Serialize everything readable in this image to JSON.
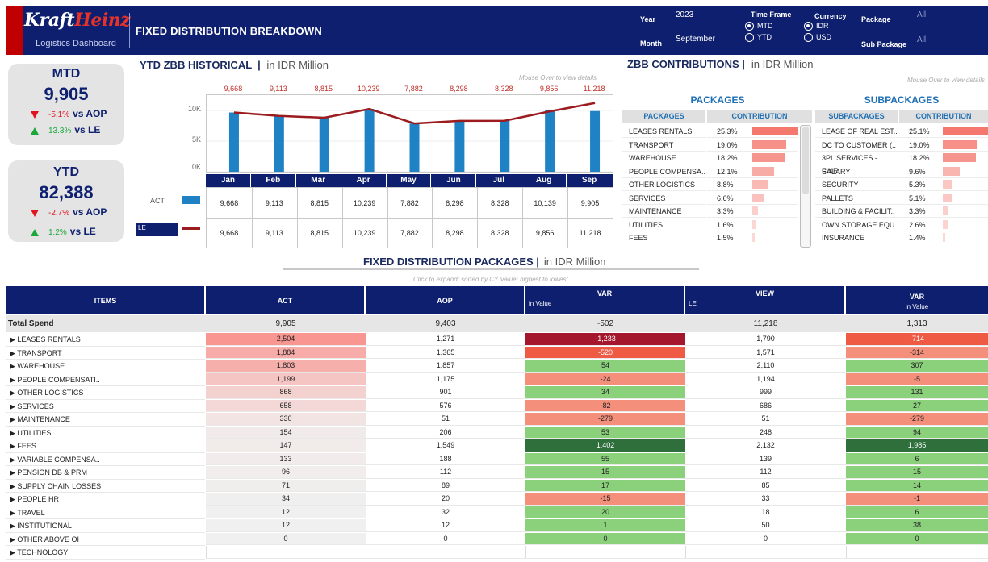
{
  "header": {
    "brand_kraft": "Kraft",
    "brand_heinz": "Heinz",
    "subtitle": "Logistics Dashboard",
    "title": "FIXED DISTRIBUTION BREAKDOWN",
    "filters": {
      "year_label": "Year",
      "year_value": "2023",
      "month_label": "Month",
      "month_value": "September",
      "timeframe_label": "Time Frame",
      "timeframe_options": [
        "MTD",
        "YTD"
      ],
      "timeframe_selected": "MTD",
      "currency_label": "Currency",
      "currency_options": [
        "IDR",
        "USD"
      ],
      "currency_selected": "IDR",
      "package_label": "Package",
      "package_value": "All",
      "subpackage_label": "Sub Package",
      "subpackage_value": "All"
    }
  },
  "kpis": [
    {
      "title": "MTD",
      "value": "9,905",
      "aop_pct": "-5.1%",
      "aop_label": "vs AOP",
      "aop_dir": "down",
      "le_pct": "13.3%",
      "le_label": "vs LE",
      "le_dir": "up"
    },
    {
      "title": "YTD",
      "value": "82,388",
      "aop_pct": "-2.7%",
      "aop_label": "vs AOP",
      "aop_dir": "down",
      "le_pct": "1.2%",
      "le_label": "vs LE",
      "le_dir": "up"
    }
  ],
  "ytd_section": {
    "title": "YTD ZBB HISTORICAL",
    "unit": "in IDR Million",
    "hint": "Mouse Over to view details",
    "legend_act": "ACT",
    "legend_le": "LE"
  },
  "chart_data": {
    "type": "bar",
    "categories": [
      "Jan",
      "Feb",
      "Mar",
      "Apr",
      "May",
      "Jun",
      "Jul",
      "Aug",
      "Sep"
    ],
    "series": [
      {
        "name": "ACT",
        "type": "bar",
        "values": [
          9668,
          9113,
          8815,
          10239,
          7882,
          8298,
          8328,
          10139,
          9905
        ],
        "labels": [
          "9,668",
          "9,113",
          "8,815",
          "10,239",
          "7,882",
          "8,298",
          "8,328",
          "10,139",
          "9,905"
        ]
      },
      {
        "name": "LE",
        "type": "line",
        "values": [
          9668,
          9113,
          8815,
          10239,
          7882,
          8298,
          8328,
          9856,
          11218
        ],
        "labels": [
          "9,668",
          "9,113",
          "8,815",
          "10,239",
          "7,882",
          "8,298",
          "8,328",
          "9,856",
          "11,218"
        ]
      }
    ],
    "yticks": [
      "0K",
      "5K",
      "10K"
    ],
    "ylim": [
      0,
      12500
    ],
    "colors": {
      "bar": "#1f82c4",
      "line": "#9b1b1f"
    }
  },
  "zbb": {
    "title": "ZBB CONTRIBUTIONS",
    "unit": "in IDR Million",
    "hint": "Mouse Over to view details",
    "packages_title": "PACKAGES",
    "subpackages_title": "SUBPACKAGES",
    "col_packages": "PACKAGES",
    "col_contribution": "CONTRIBUTION",
    "col_subpackages": "SUBPACKAGES",
    "packages": [
      {
        "name": "LEASES RENTALS",
        "pct": "25.3%",
        "v": 25.3
      },
      {
        "name": "TRANSPORT",
        "pct": "19.0%",
        "v": 19.0
      },
      {
        "name": "WAREHOUSE",
        "pct": "18.2%",
        "v": 18.2
      },
      {
        "name": "PEOPLE COMPENSA..",
        "pct": "12.1%",
        "v": 12.1
      },
      {
        "name": "OTHER LOGISTICS",
        "pct": "8.8%",
        "v": 8.8
      },
      {
        "name": "SERVICES",
        "pct": "6.6%",
        "v": 6.6
      },
      {
        "name": "MAINTENANCE",
        "pct": "3.3%",
        "v": 3.3
      },
      {
        "name": "UTILITIES",
        "pct": "1.6%",
        "v": 1.6
      },
      {
        "name": "FEES",
        "pct": "1.5%",
        "v": 1.5
      }
    ],
    "subpackages": [
      {
        "name": "LEASE OF REAL EST..",
        "pct": "25.1%",
        "v": 25.1
      },
      {
        "name": "DC TO CUSTOMER (..",
        "pct": "19.0%",
        "v": 19.0
      },
      {
        "name": "3PL SERVICES - FIXE..",
        "pct": "18.2%",
        "v": 18.2
      },
      {
        "name": "SALARY",
        "pct": "9.6%",
        "v": 9.6
      },
      {
        "name": "SECURITY",
        "pct": "5.3%",
        "v": 5.3
      },
      {
        "name": "PALLETS",
        "pct": "5.1%",
        "v": 5.1
      },
      {
        "name": "BUILDING & FACILIT..",
        "pct": "3.3%",
        "v": 3.3
      },
      {
        "name": "OWN STORAGE EQU..",
        "pct": "2.6%",
        "v": 2.6
      },
      {
        "name": "INSURANCE",
        "pct": "1.4%",
        "v": 1.4
      }
    ]
  },
  "packages_table": {
    "title": "FIXED DISTRIBUTION PACKAGES",
    "unit": "in IDR Million",
    "hint": "Click to expand; sorted by CY Value: highest to lowest",
    "headers": {
      "items": "ITEMS",
      "act": "ACT",
      "aop": "AOP",
      "var1_top": "VAR",
      "var1_bottom": "in Value",
      "view_top": "VIEW",
      "view_bottom": "LE",
      "var2_top": "VAR",
      "var2_bottom": "in Value"
    },
    "total": {
      "label": "Total Spend",
      "act": "9,905",
      "aop": "9,403",
      "var1": "-502",
      "le": "11,218",
      "var2": "1,313"
    },
    "rows": [
      {
        "item": "▶ LEASES RENTALS",
        "act": "2,504",
        "aop": "1,271",
        "var1": "-1,233",
        "le": "1,790",
        "var2": "-714",
        "a": 2504,
        "v1": -1233,
        "v2": -714
      },
      {
        "item": "▶ TRANSPORT",
        "act": "1,884",
        "aop": "1,365",
        "var1": "-520",
        "le": "1,571",
        "var2": "-314",
        "a": 1884,
        "v1": -520,
        "v2": -314
      },
      {
        "item": "▶ WAREHOUSE",
        "act": "1,803",
        "aop": "1,857",
        "var1": "54",
        "le": "2,110",
        "var2": "307",
        "a": 1803,
        "v1": 54,
        "v2": 307
      },
      {
        "item": "▶ PEOPLE COMPENSATI..",
        "act": "1,199",
        "aop": "1,175",
        "var1": "-24",
        "le": "1,194",
        "var2": "-5",
        "a": 1199,
        "v1": -24,
        "v2": -5
      },
      {
        "item": "▶ OTHER LOGISTICS",
        "act": "868",
        "aop": "901",
        "var1": "34",
        "le": "999",
        "var2": "131",
        "a": 868,
        "v1": 34,
        "v2": 131
      },
      {
        "item": "▶ SERVICES",
        "act": "658",
        "aop": "576",
        "var1": "-82",
        "le": "686",
        "var2": "27",
        "a": 658,
        "v1": -82,
        "v2": 27
      },
      {
        "item": "▶ MAINTENANCE",
        "act": "330",
        "aop": "51",
        "var1": "-279",
        "le": "51",
        "var2": "-279",
        "a": 330,
        "v1": -279,
        "v2": -279
      },
      {
        "item": "▶ UTILITIES",
        "act": "154",
        "aop": "206",
        "var1": "53",
        "le": "248",
        "var2": "94",
        "a": 154,
        "v1": 53,
        "v2": 94
      },
      {
        "item": "▶ FEES",
        "act": "147",
        "aop": "1,549",
        "var1": "1,402",
        "le": "2,132",
        "var2": "1,985",
        "a": 147,
        "v1": 1402,
        "v2": 1985
      },
      {
        "item": "▶ VARIABLE COMPENSA..",
        "act": "133",
        "aop": "188",
        "var1": "55",
        "le": "139",
        "var2": "6",
        "a": 133,
        "v1": 55,
        "v2": 6
      },
      {
        "item": "▶ PENSION DB & PRM",
        "act": "96",
        "aop": "112",
        "var1": "15",
        "le": "112",
        "var2": "15",
        "a": 96,
        "v1": 15,
        "v2": 15
      },
      {
        "item": "▶ SUPPLY CHAIN LOSSES",
        "act": "71",
        "aop": "89",
        "var1": "17",
        "le": "85",
        "var2": "14",
        "a": 71,
        "v1": 17,
        "v2": 14
      },
      {
        "item": "▶ PEOPLE HR",
        "act": "34",
        "aop": "20",
        "var1": "-15",
        "le": "33",
        "var2": "-1",
        "a": 34,
        "v1": -15,
        "v2": -1
      },
      {
        "item": "▶ TRAVEL",
        "act": "12",
        "aop": "32",
        "var1": "20",
        "le": "18",
        "var2": "6",
        "a": 12,
        "v1": 20,
        "v2": 6
      },
      {
        "item": "▶ INSTITUTIONAL",
        "act": "12",
        "aop": "12",
        "var1": "1",
        "le": "50",
        "var2": "38",
        "a": 12,
        "v1": 1,
        "v2": 38
      },
      {
        "item": "▶ OTHER ABOVE OI",
        "act": "0",
        "aop": "0",
        "var1": "0",
        "le": "0",
        "var2": "0",
        "a": 0,
        "v1": 0,
        "v2": 0
      },
      {
        "item": "▶ TECHNOLOGY",
        "act": "",
        "aop": "",
        "var1": "",
        "le": "",
        "var2": "",
        "a": null,
        "v1": null,
        "v2": null
      }
    ]
  }
}
